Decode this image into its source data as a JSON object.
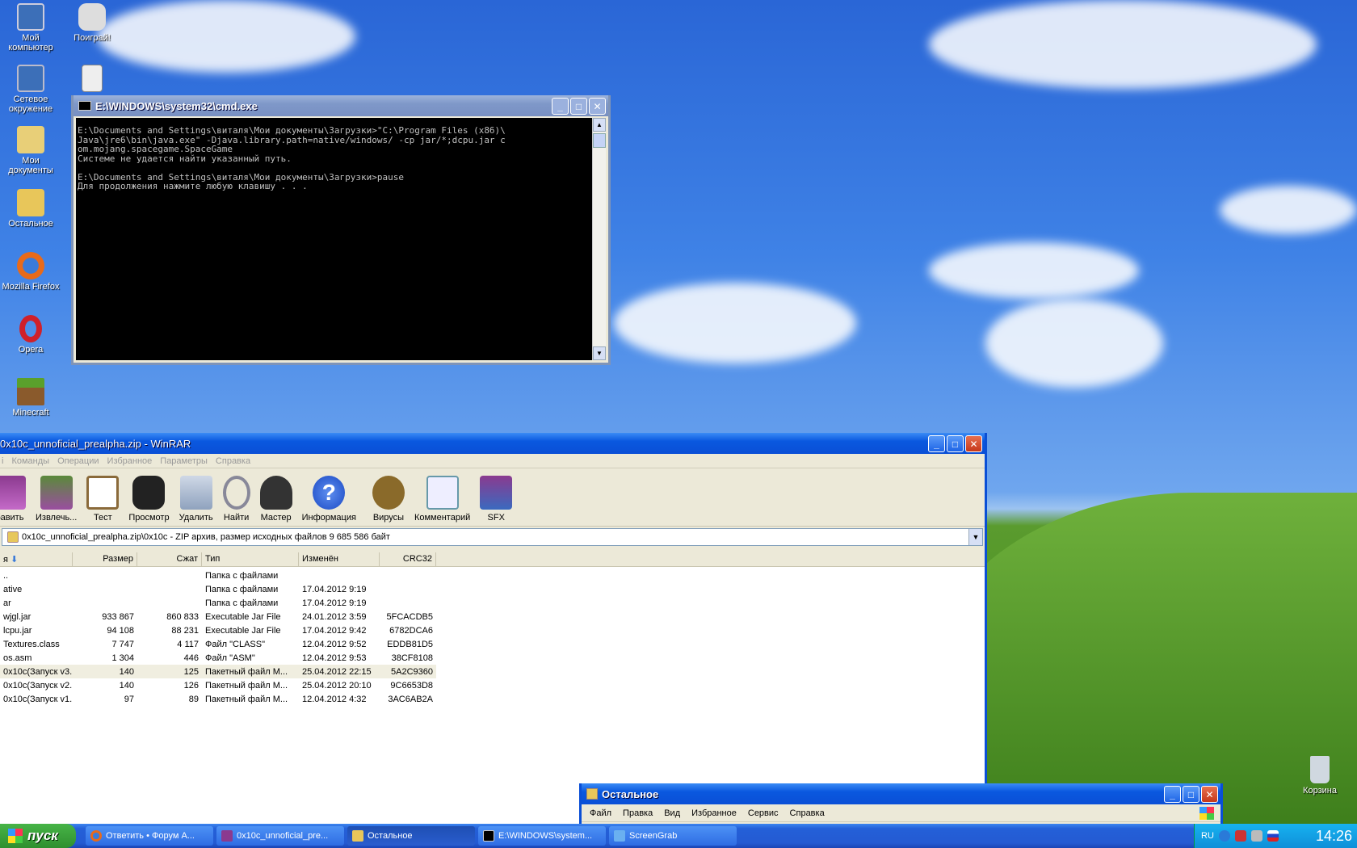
{
  "desktop_icons": [
    {
      "label": "Мой компьютер",
      "icon": "my-computer-icon"
    },
    {
      "label": "Поиграй!",
      "icon": "gamepad-icon"
    },
    {
      "label": "Сетевое окружение",
      "icon": "network-icon"
    },
    {
      "label": "Мои документы",
      "icon": "my-documents-icon"
    },
    {
      "label": "Остальное",
      "icon": "folder-icon"
    },
    {
      "label": "Mozilla Firefox",
      "icon": "firefox-icon"
    },
    {
      "label": "Opera",
      "icon": "opera-icon"
    },
    {
      "label": "Minecraft",
      "icon": "minecraft-icon"
    },
    {
      "label": "Корзина",
      "icon": "recycle-bin-icon"
    }
  ],
  "cmd": {
    "title": "E:\\WINDOWS\\system32\\cmd.exe",
    "output": "E:\\Documents and Settings\\виталя\\Мои документы\\Загрузки>\"C:\\Program Files (x86)\\\nJava\\jre6\\bin\\java.exe\" -Djava.library.path=native/windows/ -cp jar/*;dcpu.jar c\nom.mojang.spacegame.SpaceGame\nСистеме не удается найти указанный путь.\n\nE:\\Documents and Settings\\виталя\\Мои документы\\Загрузки>pause\nДля продолжения нажмите любую клавишу . . ."
  },
  "winrar": {
    "title": "0x10c_unnoficial_prealpha.zip - WinRAR",
    "menu": [
      "Команды",
      "Операции",
      "Избранное",
      "Параметры",
      "Справка"
    ],
    "tools": [
      "бавить",
      "Извлечь...",
      "Тест",
      "Просмотр",
      "Удалить",
      "Найти",
      "Мастер",
      "Информация",
      "Вирусы",
      "Комментарий",
      "SFX"
    ],
    "address": "0x10c_unnoficial_prealpha.zip\\0x10c - ZIP архив, размер исходных файлов 9 685 586 байт",
    "columns": [
      "я",
      "Размер",
      "Сжат",
      "Тип",
      "Изменён",
      "CRC32"
    ],
    "rows": [
      [
        "..",
        "",
        "",
        "Папка с файлами",
        "",
        ""
      ],
      [
        "ative",
        "",
        "",
        "Папка с файлами",
        "17.04.2012 9:19",
        ""
      ],
      [
        "ar",
        "",
        "",
        "Папка с файлами",
        "17.04.2012 9:19",
        ""
      ],
      [
        "wjgl.jar",
        "933 867",
        "860 833",
        "Executable Jar File",
        "24.01.2012 3:59",
        "5FCACDB5"
      ],
      [
        "lcpu.jar",
        "94 108",
        "88 231",
        "Executable Jar File",
        "17.04.2012 9:42",
        "6782DCA6"
      ],
      [
        "Textures.class",
        "7 747",
        "4 117",
        "Файл \"CLASS\"",
        "12.04.2012 9:52",
        "EDDB81D5"
      ],
      [
        "os.asm",
        "1 304",
        "446",
        "Файл \"ASM\"",
        "12.04.2012 9:53",
        "38CF8108"
      ],
      [
        "0x10c(Запуск v3...",
        "140",
        "125",
        "Пакетный файл M...",
        "25.04.2012 22:15",
        "5A2C9360"
      ],
      [
        "0x10c(Запуск v2...",
        "140",
        "126",
        "Пакетный файл M...",
        "25.04.2012 20:10",
        "9C6653D8"
      ],
      [
        "0x10c(Запуск v1...",
        "97",
        "89",
        "Пакетный файл M...",
        "12.04.2012 4:32",
        "3AC6AB2A"
      ]
    ]
  },
  "explorer": {
    "title": "Остальное",
    "menu": [
      "Файл",
      "Правка",
      "Вид",
      "Избранное",
      "Сервис",
      "Справка"
    ]
  },
  "taskbar": {
    "start": "пуск",
    "tasks": [
      "Ответить • Форум А...",
      "0x10c_unnoficial_pre...",
      "Остальное",
      "E:\\WINDOWS\\system...",
      "ScreenGrab"
    ],
    "lang": "RU",
    "clock": "14:26"
  }
}
